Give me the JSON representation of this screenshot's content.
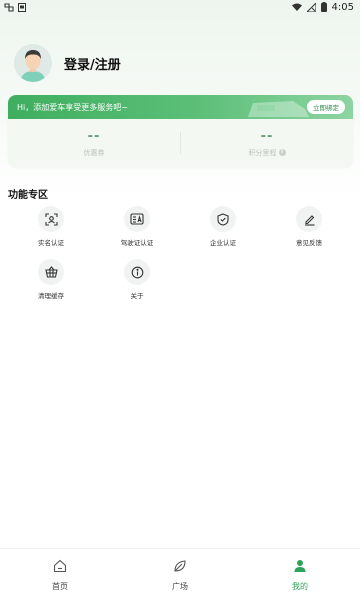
{
  "status_bar": {
    "time": "4:05",
    "left_icons": [
      "notification-bug-icon",
      "app-notification-icon"
    ],
    "right_icons": [
      "wifi-icon",
      "sim-no-signal-icon",
      "battery-icon"
    ]
  },
  "profile": {
    "login_label": "登录/注册"
  },
  "member_card": {
    "banner_text": "Hi，添加爱车享受更多服务吧~",
    "bind_button": "立即绑定",
    "stats": [
      {
        "value": "--",
        "label": "优惠券"
      },
      {
        "value": "--",
        "label": "积分里程"
      }
    ]
  },
  "features": {
    "title": "功能专区",
    "items": [
      {
        "label": "实名认证",
        "icon": "face-scan-icon"
      },
      {
        "label": "驾驶证认证",
        "icon": "license-card-icon"
      },
      {
        "label": "企业认证",
        "icon": "shield-check-icon"
      },
      {
        "label": "意见反馈",
        "icon": "edit-pen-icon"
      },
      {
        "label": "清理缓存",
        "icon": "basket-icon"
      },
      {
        "label": "关于",
        "icon": "info-icon"
      }
    ]
  },
  "bottom_nav": {
    "items": [
      {
        "label": "首页",
        "icon": "home-icon",
        "active": false
      },
      {
        "label": "广场",
        "icon": "leaf-icon",
        "active": false
      },
      {
        "label": "我的",
        "icon": "person-icon",
        "active": true
      }
    ]
  },
  "colors": {
    "accent": "#2ea35a",
    "banner_start": "#3fae5f",
    "banner_end": "#8ed4a2",
    "card_bg": "#f3f8f3"
  }
}
